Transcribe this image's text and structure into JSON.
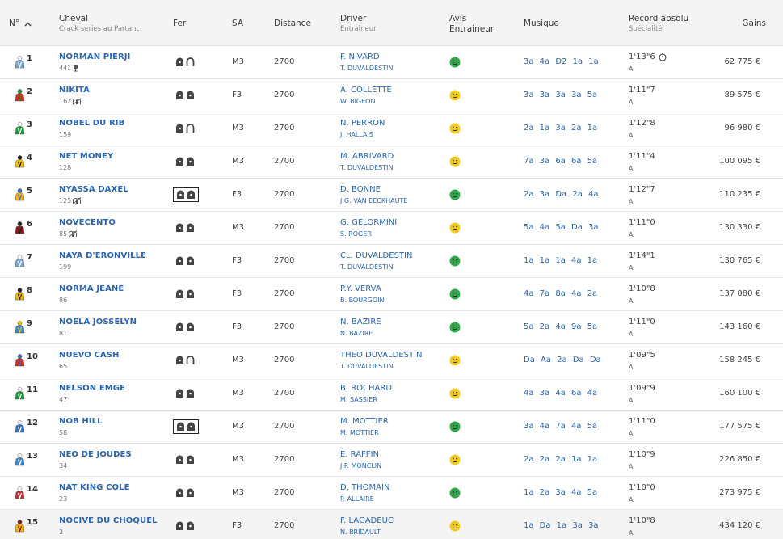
{
  "header": {
    "num": "N°",
    "cheval": "Cheval",
    "cheval_sub": "Crack series au Partant",
    "fer": "Fer",
    "sa": "SA",
    "distance": "Distance",
    "driver": "Driver",
    "driver_sub": "Entraîneur",
    "avis_line1": "Avis",
    "avis_line2": "Entraineur",
    "musique": "Musique",
    "record": "Record absolu",
    "record_sub": "Spécialité",
    "gains": "Gains"
  },
  "colors": {
    "link": "#2a66b5",
    "happy": "#2ea64a",
    "neutral": "#f2cb1d"
  },
  "runners": [
    {
      "num": "1",
      "name": "NORMAN PIERJI",
      "meta": "441",
      "meta_icon": "trophy-icon",
      "fer": "front-rear-open",
      "boxed": false,
      "sa": "M3",
      "distance": "2700",
      "driver": "F. NIVARD",
      "trainer": "T. DUVALDESTIN",
      "avis": "happy",
      "musique": "3a 4a D2 1a 1a",
      "record": "1'13\"6",
      "record_icon": "stopwatch-icon",
      "spec": "A",
      "gains": "62 775 €",
      "silk": [
        "#7aa7d8",
        "#ffffff"
      ]
    },
    {
      "num": "2",
      "name": "NIKITA",
      "meta": "162",
      "meta_icon": "no-shoes-icon",
      "fer": "both",
      "boxed": false,
      "sa": "F3",
      "distance": "2700",
      "driver": "A. COLLETTE",
      "trainer": "W. BIGEON",
      "avis": "neutral",
      "musique": "3a 3a 3a 3a 5a",
      "record": "1'11\"7",
      "record_icon": "",
      "spec": "A",
      "gains": "89 575 €",
      "silk": [
        "#d8261f",
        "#1f8f3a"
      ]
    },
    {
      "num": "3",
      "name": "NOBEL DU RIB",
      "meta": "159",
      "meta_icon": "",
      "fer": "front-rear-open",
      "boxed": false,
      "sa": "M3",
      "distance": "2700",
      "driver": "N. PERRON",
      "trainer": "J. HALLAIS",
      "avis": "neutral",
      "musique": "2a 1a 3a 2a 1a",
      "record": "1'12\"8",
      "record_icon": "",
      "spec": "A",
      "gains": "96 980 €",
      "silk": [
        "#1e9a3c",
        "#ffffff"
      ]
    },
    {
      "num": "4",
      "name": "NET MONEY",
      "meta": "128",
      "meta_icon": "",
      "fer": "both",
      "boxed": false,
      "sa": "M3",
      "distance": "2700",
      "driver": "M. ABRIVARD",
      "trainer": "T. DUVALDESTIN",
      "avis": "neutral",
      "musique": "7a 3a 6a 6a 5a",
      "record": "1'11\"4",
      "record_icon": "",
      "spec": "A",
      "gains": "100 095 €",
      "silk": [
        "#f2c200",
        "#222222"
      ]
    },
    {
      "num": "5",
      "name": "NYASSA DAXEL",
      "meta": "125",
      "meta_icon": "no-shoes-icon",
      "fer": "both",
      "boxed": true,
      "sa": "F3",
      "distance": "2700",
      "driver": "D. BONNE",
      "trainer": "J.G. VAN EECKHAUTE",
      "avis": "happy",
      "musique": "2a 3a Da 2a 4a",
      "record": "1'12\"7",
      "record_icon": "",
      "spec": "A",
      "gains": "110 235 €",
      "silk": [
        "#f0b21a",
        "#3a6fc4"
      ]
    },
    {
      "num": "6",
      "name": "NOVECENTO",
      "meta": "85",
      "meta_icon": "no-shoes-icon",
      "fer": "both",
      "boxed": false,
      "sa": "M3",
      "distance": "2700",
      "driver": "G. GELORMINI",
      "trainer": "S. ROGER",
      "avis": "neutral",
      "musique": "5a 4a 5a Da 3a",
      "record": "1'11\"0",
      "record_icon": "",
      "spec": "A",
      "gains": "130 330 €",
      "silk": [
        "#8a1a1a",
        "#222222"
      ]
    },
    {
      "num": "7",
      "name": "NAYA D'ERONVILLE",
      "meta": "199",
      "meta_icon": "",
      "fer": "both",
      "boxed": false,
      "sa": "F3",
      "distance": "2700",
      "driver": "CL. DUVALDESTIN",
      "trainer": "T. DUVALDESTIN",
      "avis": "happy",
      "musique": "1a 1a 1a 4a 1a",
      "record": "1'14\"1",
      "record_icon": "",
      "spec": "A",
      "gains": "130 765 €",
      "silk": [
        "#7aa7d8",
        "#ffffff"
      ]
    },
    {
      "num": "8",
      "name": "NORMA JEANE",
      "meta": "86",
      "meta_icon": "",
      "fer": "both",
      "boxed": false,
      "sa": "F3",
      "distance": "2700",
      "driver": "P.Y. VERVA",
      "trainer": "B. BOURGOIN",
      "avis": "happy",
      "musique": "4a 7a 8a 4a 2a",
      "record": "1'10\"8",
      "record_icon": "",
      "spec": "A",
      "gains": "137 080 €",
      "silk": [
        "#f2b700",
        "#222222"
      ]
    },
    {
      "num": "9",
      "name": "NOELA JOSSELYN",
      "meta": "81",
      "meta_icon": "",
      "fer": "both",
      "boxed": false,
      "sa": "F3",
      "distance": "2700",
      "driver": "N. BAZIRE",
      "trainer": "N. BAZIRE",
      "avis": "happy",
      "musique": "5a 2a 4a 9a 5a",
      "record": "1'11\"0",
      "record_icon": "",
      "spec": "A",
      "gains": "143 160 €",
      "silk": [
        "#3a86d1",
        "#f2c200"
      ]
    },
    {
      "num": "10",
      "name": "NUEVO CASH",
      "meta": "65",
      "meta_icon": "",
      "fer": "front-rear-open",
      "boxed": false,
      "sa": "M3",
      "distance": "2700",
      "driver": "THEO DUVALDESTIN",
      "trainer": "T. DUVALDESTIN",
      "avis": "neutral",
      "musique": "Da Aa 2a Da Da",
      "record": "1'09\"5",
      "record_icon": "",
      "spec": "A",
      "gains": "158 245 €",
      "silk": [
        "#d8261f",
        "#3a6fc4"
      ]
    },
    {
      "num": "11",
      "name": "NELSON EMGE",
      "meta": "47",
      "meta_icon": "",
      "fer": "both",
      "boxed": false,
      "sa": "M3",
      "distance": "2700",
      "driver": "B. ROCHARD",
      "trainer": "M. SASSIER",
      "avis": "neutral",
      "musique": "4a 3a 4a 6a 4a",
      "record": "1'09\"9",
      "record_icon": "",
      "spec": "A",
      "gains": "160 100 €",
      "silk": [
        "#1e9a3c",
        "#ffffff"
      ]
    },
    {
      "num": "12",
      "name": "NOB HILL",
      "meta": "58",
      "meta_icon": "",
      "fer": "both",
      "boxed": true,
      "sa": "M3",
      "distance": "2700",
      "driver": "M. MOTTIER",
      "trainer": "M. MOTTIER",
      "avis": "happy",
      "musique": "3a 4a 7a 4a 5a",
      "record": "1'11\"0",
      "record_icon": "",
      "spec": "A",
      "gains": "177 575 €",
      "silk": [
        "#3a6fc4",
        "#ffffff"
      ]
    },
    {
      "num": "13",
      "name": "NEO DE JOUDES",
      "meta": "34",
      "meta_icon": "",
      "fer": "both",
      "boxed": false,
      "sa": "M3",
      "distance": "2700",
      "driver": "E. RAFFIN",
      "trainer": "J.P. MONCLIN",
      "avis": "neutral",
      "musique": "2a 2a 2a 1a 1a",
      "record": "1'10\"9",
      "record_icon": "",
      "spec": "A",
      "gains": "226 850 €",
      "silk": [
        "#3a86d1",
        "#ffffff"
      ]
    },
    {
      "num": "14",
      "name": "NAT KING COLE",
      "meta": "23",
      "meta_icon": "",
      "fer": "both",
      "boxed": false,
      "sa": "M3",
      "distance": "2700",
      "driver": "D. THOMAIN",
      "trainer": "P. ALLAIRE",
      "avis": "happy",
      "musique": "1a 2a 3a 4a 5a",
      "record": "1'10\"0",
      "record_icon": "",
      "spec": "A",
      "gains": "273 975 €",
      "silk": [
        "#c0323a",
        "#ffffff"
      ]
    },
    {
      "num": "15",
      "name": "NOCIVE DU CHOQUEL",
      "meta": "2",
      "meta_icon": "",
      "fer": "both",
      "boxed": false,
      "sa": "F3",
      "distance": "2700",
      "driver": "F. LAGADEUC",
      "trainer": "N. BRIDAULT",
      "avis": "neutral",
      "musique": "1a Da 1a 3a 3a",
      "record": "1'10\"8",
      "record_icon": "",
      "spec": "A",
      "gains": "434 120 €",
      "silk": [
        "#f2b700",
        "#8a1a1a"
      ]
    }
  ]
}
